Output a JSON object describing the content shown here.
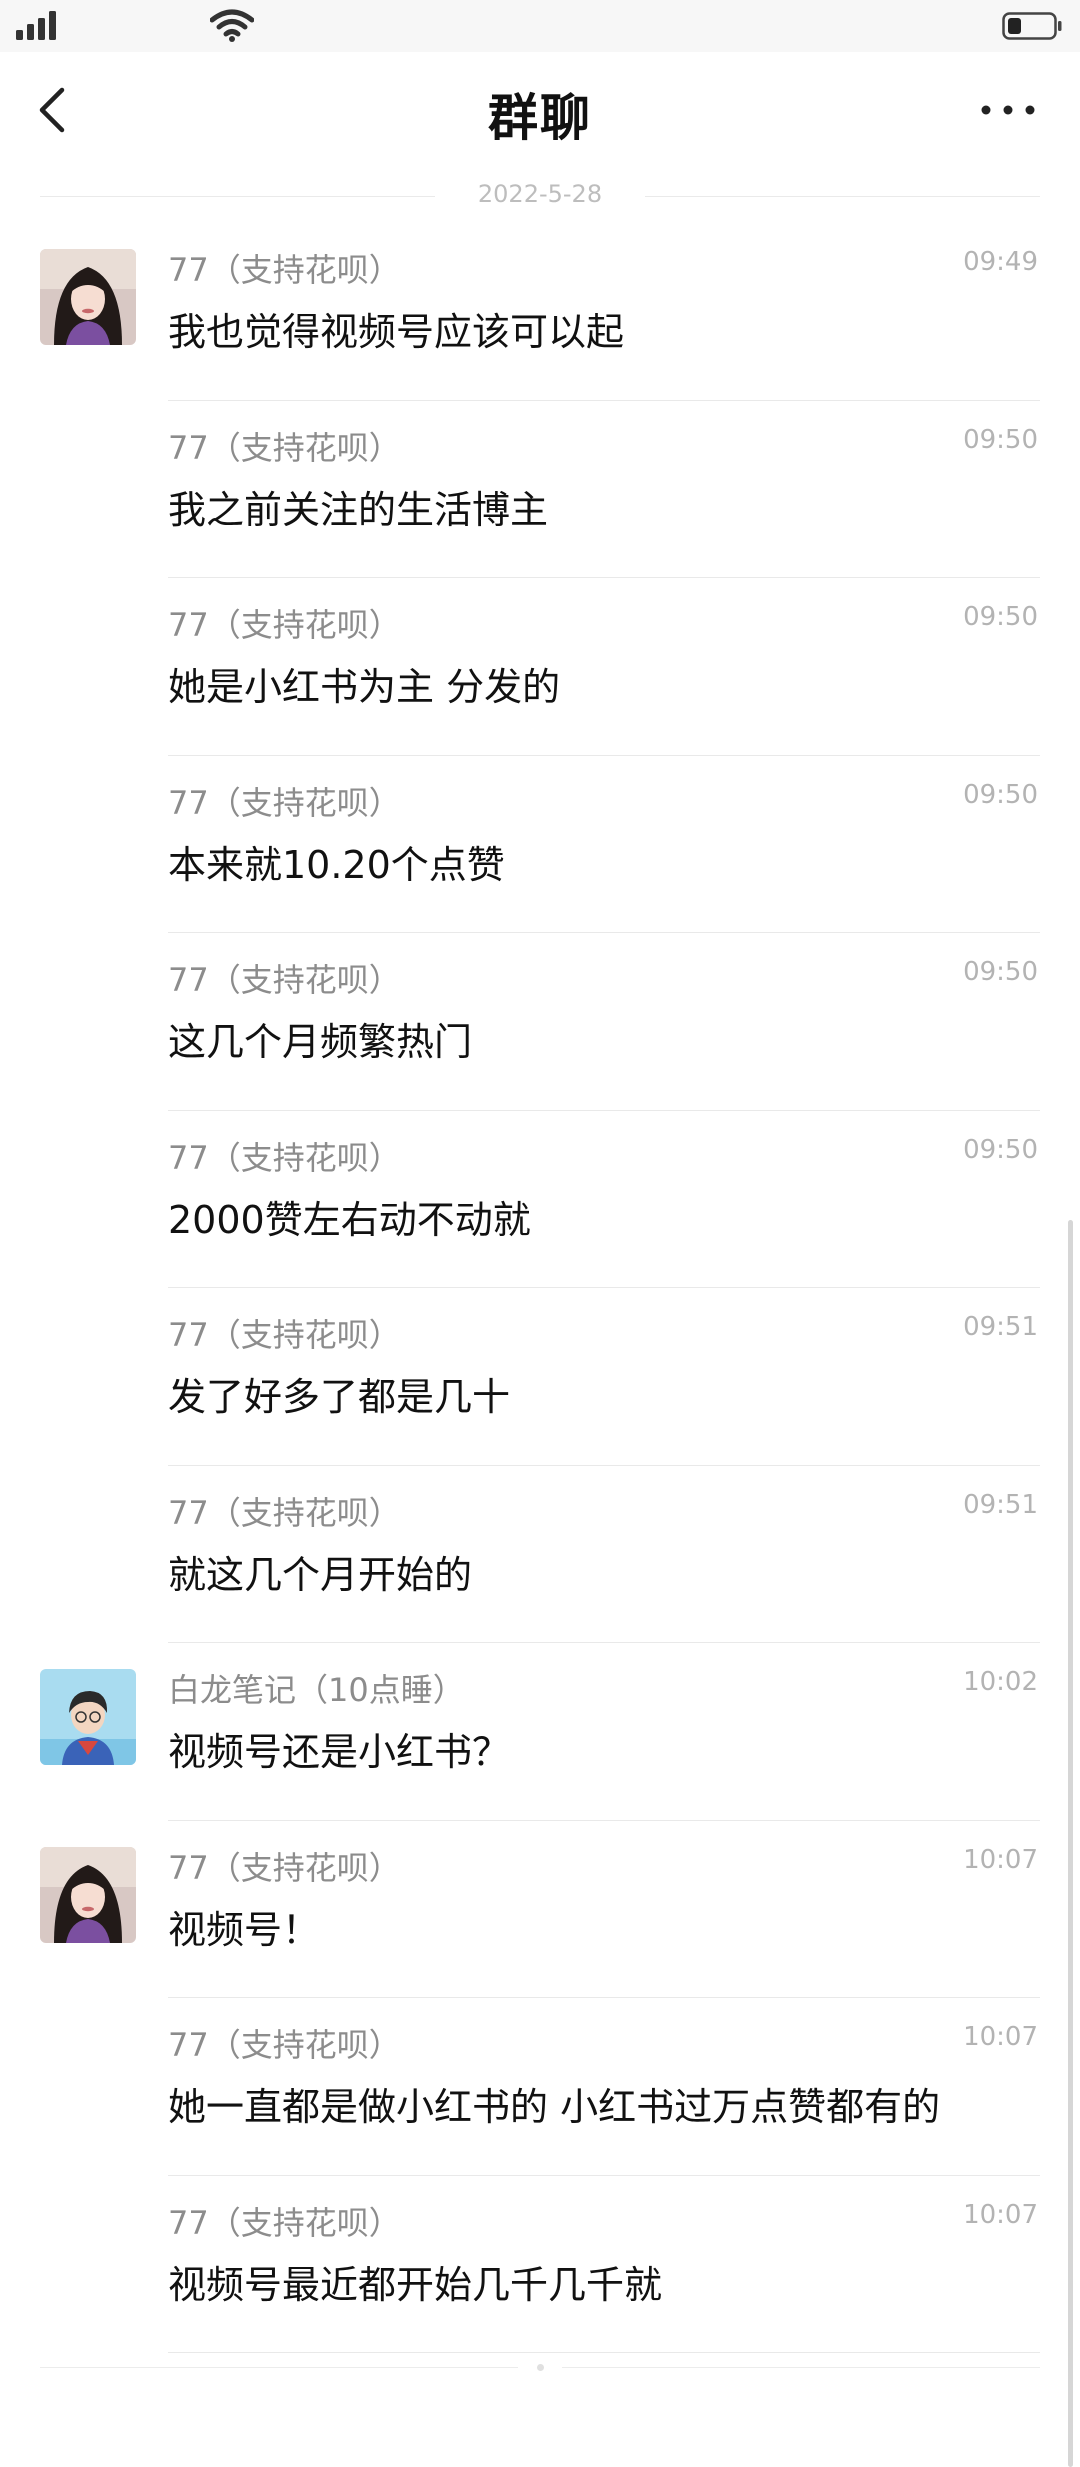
{
  "status_bar": {
    "signal_icon": "signal-icon",
    "wifi_icon": "wifi-icon",
    "battery_icon": "battery-icon",
    "battery_level": 0.3
  },
  "header": {
    "title": "群聊",
    "back_icon": "chevron-left-icon",
    "more_icon": "more-icon"
  },
  "date_divider": "2022-5-28",
  "messages": [
    {
      "sender": "77（支持花呗）",
      "time": "09:49",
      "text": "我也觉得视频号应该可以起",
      "avatar": "avatar-girl"
    },
    {
      "sender": "77（支持花呗）",
      "time": "09:50",
      "text": "我之前关注的生活博主"
    },
    {
      "sender": "77（支持花呗）",
      "time": "09:50",
      "text": "她是小红书为主 分发的"
    },
    {
      "sender": "77（支持花呗）",
      "time": "09:50",
      "text": "本来就10.20个点赞"
    },
    {
      "sender": "77（支持花呗）",
      "time": "09:50",
      "text": "这几个月频繁热门"
    },
    {
      "sender": "77（支持花呗）",
      "time": "09:50",
      "text": "2000赞左右动不动就"
    },
    {
      "sender": "77（支持花呗）",
      "time": "09:51",
      "text": "发了好多了都是几十"
    },
    {
      "sender": "77（支持花呗）",
      "time": "09:51",
      "text": "就这几个月开始的"
    },
    {
      "sender": "白龙笔记（10点睡）",
      "time": "10:02",
      "text": "视频号还是小红书？",
      "avatar": "avatar-boy"
    },
    {
      "sender": "77（支持花呗）",
      "time": "10:07",
      "text": "视频号！",
      "avatar": "avatar-girl"
    },
    {
      "sender": "77（支持花呗）",
      "time": "10:07",
      "text": "她一直都是做小红书的 小红书过万点赞都有的"
    },
    {
      "sender": "77（支持花呗）",
      "time": "10:07",
      "text": "视频号最近都开始几千几千就"
    }
  ],
  "colors": {
    "accent_text": "#111111",
    "sender_text": "#8c8c8c",
    "time_text": "#b3b3b3",
    "separator": "#e9e9e9"
  }
}
